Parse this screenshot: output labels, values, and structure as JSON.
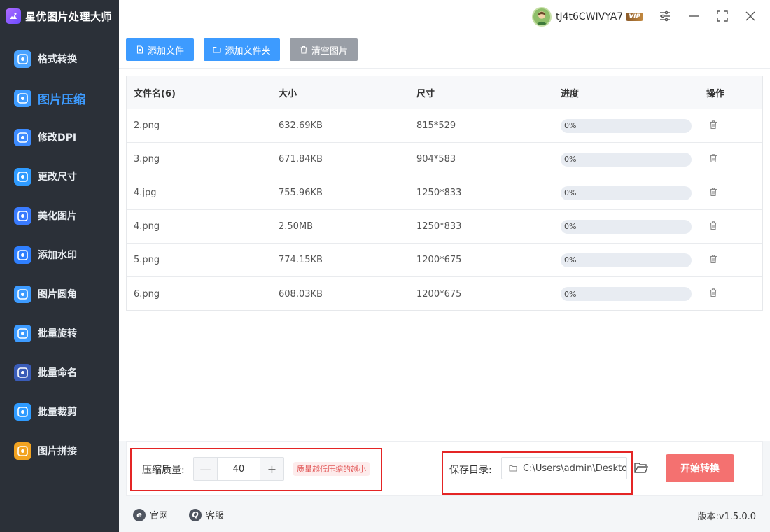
{
  "app": {
    "title": "星优图片处理大师"
  },
  "user": {
    "name": "tJ4t6CWIVYA7",
    "badge": "VIP"
  },
  "sidebar": {
    "items": [
      {
        "label": "格式转换",
        "icon": "image-convert-icon",
        "color": "#4aa3ff"
      },
      {
        "label": "图片压缩",
        "icon": "image-compress-icon",
        "color": "#3d9bff",
        "active": true
      },
      {
        "label": "修改DPI",
        "icon": "dpi-icon",
        "color": "#3d8bff"
      },
      {
        "label": "更改尺寸",
        "icon": "resize-icon",
        "color": "#2f9bff"
      },
      {
        "label": "美化图片",
        "icon": "beautify-icon",
        "color": "#3a7bff"
      },
      {
        "label": "添加水印",
        "icon": "watermark-icon",
        "color": "#2f7fff"
      },
      {
        "label": "图片圆角",
        "icon": "round-corner-icon",
        "color": "#3d9bff"
      },
      {
        "label": "批量旋转",
        "icon": "rotate-icon",
        "color": "#3d9bff"
      },
      {
        "label": "批量命名",
        "icon": "rename-icon",
        "color": "#3a5cb8"
      },
      {
        "label": "批量裁剪",
        "icon": "crop-icon",
        "color": "#2f9bff"
      },
      {
        "label": "图片拼接",
        "icon": "puzzle-icon",
        "color": "#f2a321"
      }
    ]
  },
  "toolbar": {
    "add_file": "添加文件",
    "add_folder": "添加文件夹",
    "clear": "清空图片"
  },
  "table": {
    "headers": [
      "文件名(6)",
      "大小",
      "尺寸",
      "进度",
      "操作"
    ],
    "rows": [
      {
        "name": "2.png",
        "size": "632.69KB",
        "dims": "815*529",
        "progress": "0%",
        "progress_value": 0
      },
      {
        "name": "3.png",
        "size": "671.84KB",
        "dims": "904*583",
        "progress": "0%",
        "progress_value": 0
      },
      {
        "name": "4.jpg",
        "size": "755.96KB",
        "dims": "1250*833",
        "progress": "0%",
        "progress_value": 0
      },
      {
        "name": "4.png",
        "size": "2.50MB",
        "dims": "1250*833",
        "progress": "0%",
        "progress_value": 0
      },
      {
        "name": "5.png",
        "size": "774.15KB",
        "dims": "1200*675",
        "progress": "0%",
        "progress_value": 0
      },
      {
        "name": "6.png",
        "size": "608.03KB",
        "dims": "1200*675",
        "progress": "0%",
        "progress_value": 0
      }
    ]
  },
  "settings": {
    "quality_label": "压缩质量:",
    "quality_value": "40",
    "quality_hint": "质量越低压缩的越小",
    "minus": "—",
    "plus": "+",
    "save_label": "保存目录:",
    "save_path": "C:\\Users\\admin\\Desktop",
    "start": "开始转换"
  },
  "footer": {
    "website": "官网",
    "support": "客服",
    "version": "版本:v1.5.0.0"
  },
  "colors": {
    "primary": "#3d9bff",
    "start_button": "#f47170",
    "highlight_box": "#e42525"
  }
}
